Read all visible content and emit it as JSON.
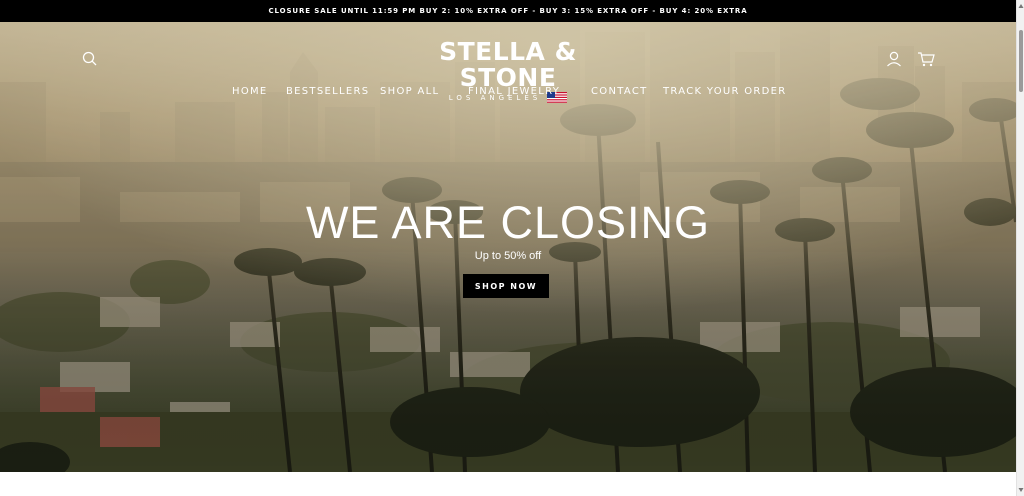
{
  "announcement": {
    "text": "CLOSURE SALE UNTIL 11:59 PM BUY 2: 10% EXTRA OFF - BUY 3: 15% EXTRA OFF - BUY 4: 20% EXTRA"
  },
  "header": {
    "logo_main": "STELLA & STONE",
    "logo_sub": "LOS ANGELES",
    "icons": [
      "search-icon",
      "account-icon",
      "cart-icon"
    ],
    "nav": [
      {
        "label": "HOME"
      },
      {
        "label": "BESTSELLERS"
      },
      {
        "label": "SHOP ALL"
      },
      {
        "label": "FINAL JEWELRY"
      },
      {
        "label": "CONTACT"
      },
      {
        "label": "TRACK YOUR ORDER"
      }
    ]
  },
  "hero": {
    "headline": "WE ARE CLOSING",
    "subheadline": "Up to 50% off",
    "cta_label": "SHOP NOW"
  },
  "colors": {
    "announcement_bg": "#000000",
    "cta_bg": "#000000",
    "text_on_image": "#ffffff"
  }
}
